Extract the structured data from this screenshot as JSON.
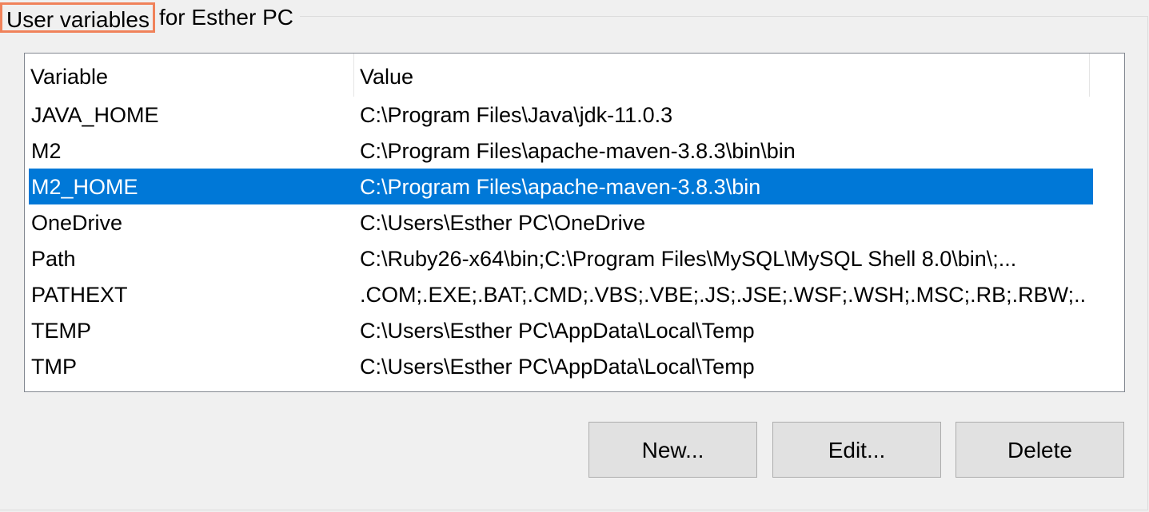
{
  "group": {
    "title_highlighted": "User variables",
    "title_rest": "for Esther PC"
  },
  "list": {
    "columns": [
      "Variable",
      "Value"
    ],
    "rows": [
      {
        "variable": "JAVA_HOME",
        "value": "C:\\Program Files\\Java\\jdk-11.0.3"
      },
      {
        "variable": "M2",
        "value": "C:\\Program Files\\apache-maven-3.8.3\\bin\\bin"
      },
      {
        "variable": "M2_HOME",
        "value": "C:\\Program Files\\apache-maven-3.8.3\\bin"
      },
      {
        "variable": "OneDrive",
        "value": "C:\\Users\\Esther PC\\OneDrive"
      },
      {
        "variable": "Path",
        "value": "C:\\Ruby26-x64\\bin;C:\\Program Files\\MySQL\\MySQL Shell 8.0\\bin\\;..."
      },
      {
        "variable": "PATHEXT",
        "value": ".COM;.EXE;.BAT;.CMD;.VBS;.VBE;.JS;.JSE;.WSF;.WSH;.MSC;.RB;.RBW;...."
      },
      {
        "variable": "TEMP",
        "value": "C:\\Users\\Esther PC\\AppData\\Local\\Temp"
      },
      {
        "variable": "TMP",
        "value": "C:\\Users\\Esther PC\\AppData\\Local\\Temp"
      }
    ],
    "selected_index": 2
  },
  "buttons": {
    "new_label": "New...",
    "edit_label": "Edit...",
    "delete_label": "Delete"
  },
  "colors": {
    "selection": "#0078d7",
    "title_highlight_border": "#f0825a"
  }
}
